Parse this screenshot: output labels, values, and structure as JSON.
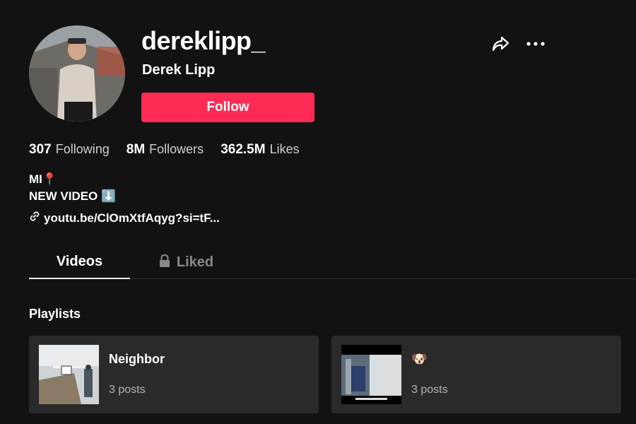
{
  "profile": {
    "username": "dereklipp_",
    "display_name": "Derek Lipp",
    "follow_label": "Follow"
  },
  "stats": [
    {
      "value": "307",
      "label": "Following"
    },
    {
      "value": "8M",
      "label": "Followers"
    },
    {
      "value": "362.5M",
      "label": "Likes"
    }
  ],
  "bio": {
    "line1": "MI📍",
    "line2": "NEW VIDEO ⬇️",
    "link": "youtu.be/ClOmXtfAqyg?si=tF..."
  },
  "tabs": {
    "videos": "Videos",
    "liked": "Liked"
  },
  "playlists": {
    "title": "Playlists",
    "items": [
      {
        "name": "Neighbor",
        "count": "3 posts"
      },
      {
        "name": "🐶",
        "count": "3 posts"
      }
    ]
  },
  "icons": {
    "share": "share-icon",
    "more": "more-icon",
    "link": "link-icon",
    "lock": "lock-icon"
  },
  "colors": {
    "background": "#121212",
    "accent": "#fe2c55",
    "card": "#2a2a2a",
    "muted": "#8a8a8a"
  }
}
